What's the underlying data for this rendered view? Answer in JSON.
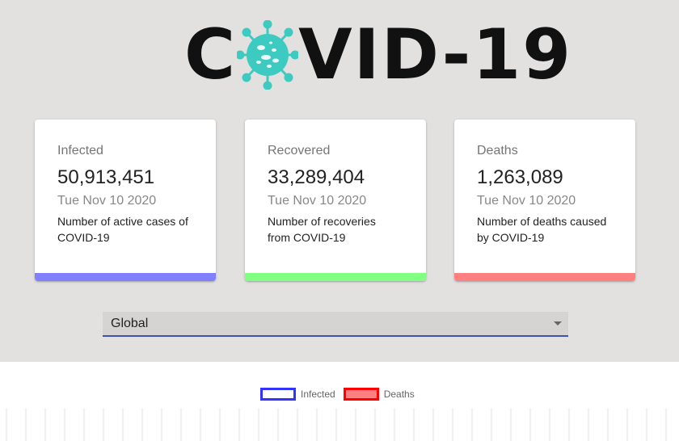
{
  "header": {
    "logo_first": "C",
    "logo_rest": "VID-19",
    "logo_icon": "virus-icon",
    "accent": "#3dcbc1"
  },
  "cards": [
    {
      "title": "Infected",
      "value": "50,913,451",
      "date": "Tue Nov 10 2020",
      "desc_line1": "Number of active cases of",
      "desc_line2": "COVID-19",
      "color": "#8080ff"
    },
    {
      "title": "Recovered",
      "value": "33,289,404",
      "date": "Tue Nov 10 2020",
      "desc_line1": "Number of recoveries",
      "desc_line2": "from COVID-19",
      "color": "#80ff80"
    },
    {
      "title": "Deaths",
      "value": "1,263,089",
      "date": "Tue Nov 10 2020",
      "desc_line1": "Number of deaths caused",
      "desc_line2": "by COVID-19",
      "color": "#ff8080"
    }
  ],
  "country_select": {
    "value": "Global",
    "icon": "chevron-down-icon"
  },
  "chart": {
    "legend": [
      {
        "label": "Infected",
        "color": "#3333ff",
        "fill": "#ffffff"
      },
      {
        "label": "Deaths",
        "color": "#ff0000",
        "fill": "#ff8080"
      }
    ]
  }
}
